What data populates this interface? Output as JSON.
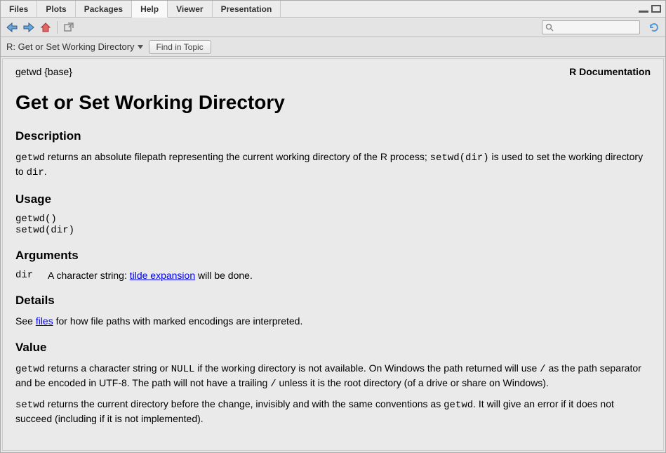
{
  "tabs": {
    "files": "Files",
    "plots": "Plots",
    "packages": "Packages",
    "help": "Help",
    "viewer": "Viewer",
    "presentation": "Presentation"
  },
  "subbar": {
    "breadcrumb": "R: Get or Set Working Directory",
    "find_in_topic": "Find in Topic"
  },
  "search": {
    "placeholder": ""
  },
  "doc": {
    "topic_header_left": "getwd {base}",
    "topic_header_right": "R Documentation",
    "title": "Get or Set Working Directory",
    "h_description": "Description",
    "desc_t1": "getwd",
    "desc_t2": " returns an absolute filepath representing the current working directory of the R process; ",
    "desc_t3": "setwd(dir)",
    "desc_t4": " is used to set the working directory to ",
    "desc_t5": "dir",
    "desc_t6": ".",
    "h_usage": "Usage",
    "usage_code": "getwd()\nsetwd(dir)",
    "h_arguments": "Arguments",
    "arg_name": "dir",
    "arg_desc_pre": "A character string: ",
    "arg_link": "tilde expansion",
    "arg_desc_post": " will be done.",
    "h_details": "Details",
    "details_pre": "See ",
    "details_link": "files",
    "details_post": " for how file paths with marked encodings are interpreted.",
    "h_value": "Value",
    "val1_t1": "getwd",
    "val1_t2": " returns a character string or ",
    "val1_t3": "NULL",
    "val1_t4": " if the working directory is not available. On Windows the path returned will use ",
    "val1_t5": "/",
    "val1_t6": " as the path separator and be encoded in UTF-8. The path will not have a trailing ",
    "val1_t7": "/",
    "val1_t8": " unless it is the root directory (of a drive or share on Windows).",
    "val2_t1": "setwd",
    "val2_t2": " returns the current directory before the change, invisibly and with the same conventions as ",
    "val2_t3": "getwd",
    "val2_t4": ". It will give an error if it does not succeed (including if it is not implemented)."
  }
}
